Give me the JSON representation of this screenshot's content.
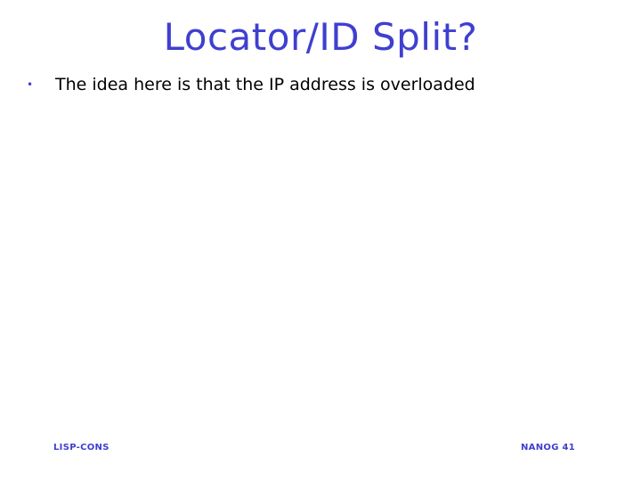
{
  "slide": {
    "title": "Locator/ID Split?",
    "bullets": [
      {
        "marker": "•",
        "text": "The idea here is that the IP address is overloaded"
      }
    ],
    "footer_left": "LISP-CONS",
    "footer_right": "NANOG 41",
    "colors": {
      "title": "#3f3fd0",
      "body_text": "#000000",
      "background": "#ffffff"
    }
  }
}
